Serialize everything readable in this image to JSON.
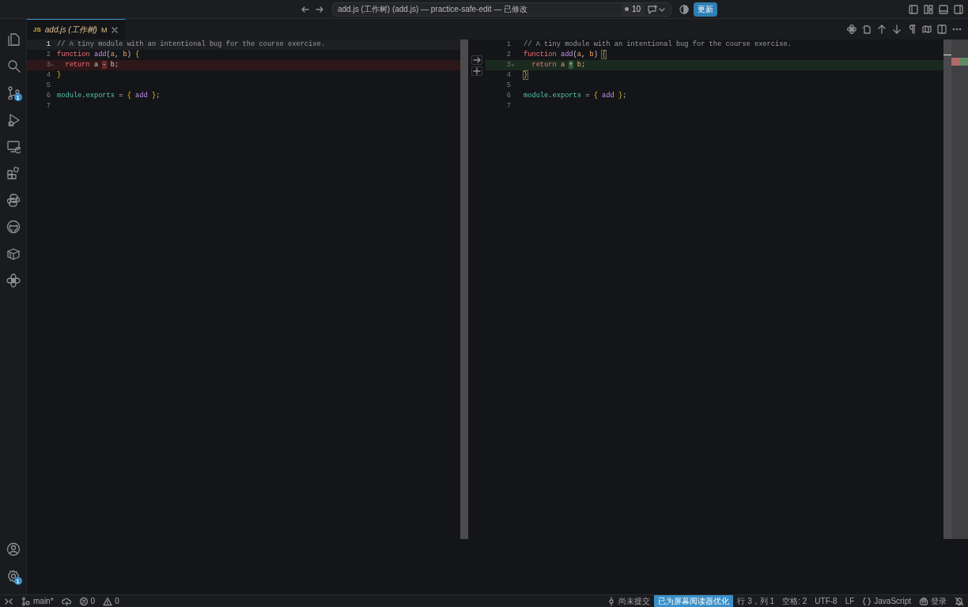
{
  "title_bar": {
    "title": "add.js (工作树) (add.js) — practice-safe-edit — 已修改",
    "changes_count": "10",
    "update_button": "更新"
  },
  "activity_bar": {
    "top": [
      {
        "kind": "files"
      },
      {
        "kind": "search"
      },
      {
        "kind": "source-control",
        "badge": "1"
      },
      {
        "kind": "run-debug"
      },
      {
        "kind": "remote"
      },
      {
        "kind": "extensions"
      },
      {
        "kind": "python"
      },
      {
        "kind": "github"
      },
      {
        "kind": "box"
      },
      {
        "kind": "flower"
      }
    ],
    "bottom": [
      {
        "kind": "account"
      },
      {
        "kind": "settings",
        "badge": "1"
      }
    ]
  },
  "tabs": [
    {
      "file_icon": "JS",
      "label": "add.js (工作树)",
      "status": "M",
      "selected": true
    }
  ],
  "diff": {
    "original": {
      "lines": [
        {
          "number": "1",
          "current": true,
          "kind": "context",
          "tokens": [
            {
              "text": "// A tiny module with an intentional bug for the course exercise.",
              "kind": "comment"
            }
          ]
        },
        {
          "number": "2",
          "current": false,
          "kind": "context",
          "tokens": [
            {
              "text": "function",
              "kind": "keyword"
            },
            {
              "text": " add",
              "kind": "function"
            },
            {
              "text": "(",
              "kind": "plain"
            },
            {
              "text": "a",
              "kind": "param"
            },
            {
              "text": ", ",
              "kind": "plain"
            },
            {
              "text": "b",
              "kind": "param"
            },
            {
              "text": ") ",
              "kind": "plain"
            },
            {
              "text": "{",
              "kind": "bracket"
            }
          ]
        },
        {
          "number": "3",
          "marker": "−",
          "current": false,
          "kind": "removed",
          "tokens": [
            {
              "text": "  return",
              "kind": "keyword"
            },
            {
              "text": " a ",
              "kind": "plain"
            },
            {
              "text": "-",
              "kind": "removed-char"
            },
            {
              "text": " b;",
              "kind": "plain"
            }
          ]
        },
        {
          "number": "4",
          "current": false,
          "kind": "context",
          "tokens": [
            {
              "text": "}",
              "kind": "bracket"
            }
          ]
        },
        {
          "number": "5",
          "current": false,
          "kind": "context"
        },
        {
          "number": "6",
          "current": false,
          "kind": "context",
          "tokens": [
            {
              "text": "module",
              "kind": "property"
            },
            {
              "text": ".",
              "kind": "plain"
            },
            {
              "text": "exports",
              "kind": "property"
            },
            {
              "text": " = ",
              "kind": "plain"
            },
            {
              "text": "{",
              "kind": "bracket"
            },
            {
              "text": " add",
              "kind": "function"
            },
            {
              "text": " }",
              "kind": "bracket"
            },
            {
              "text": ";",
              "kind": "plain"
            }
          ]
        },
        {
          "number": "7",
          "current": false,
          "kind": "context"
        }
      ]
    },
    "modified": {
      "lines": [
        {
          "number": "1",
          "current": false,
          "kind": "context",
          "tokens": [
            {
              "text": "// A tiny module with an intentional bug for the course exercise.",
              "kind": "comment"
            }
          ]
        },
        {
          "number": "2",
          "current": false,
          "kind": "context",
          "tokens": [
            {
              "text": "function",
              "kind": "keyword"
            },
            {
              "text": " add",
              "kind": "function"
            },
            {
              "text": "(",
              "kind": "plain"
            },
            {
              "text": "a",
              "kind": "param"
            },
            {
              "text": ", ",
              "kind": "plain"
            },
            {
              "text": "b",
              "kind": "param"
            },
            {
              "text": ") ",
              "kind": "plain"
            },
            {
              "text": "{",
              "kind": "bracket-match"
            }
          ]
        },
        {
          "number": "3",
          "marker": "+",
          "current": false,
          "kind": "added",
          "tokens": [
            {
              "text": "  return",
              "kind": "keyword"
            },
            {
              "text": " a ",
              "kind": "param"
            },
            {
              "text": "+",
              "kind": "added-char"
            },
            {
              "text": " b",
              "kind": "param"
            },
            {
              "text": ";",
              "kind": "plain"
            }
          ]
        },
        {
          "number": "4",
          "current": false,
          "kind": "context",
          "tokens": [
            {
              "text": "}",
              "kind": "bracket-match"
            }
          ]
        },
        {
          "number": "5",
          "current": false,
          "kind": "context"
        },
        {
          "number": "6",
          "current": false,
          "kind": "context",
          "tokens": [
            {
              "text": "module",
              "kind": "property"
            },
            {
              "text": ".",
              "kind": "plain"
            },
            {
              "text": "exports",
              "kind": "property"
            },
            {
              "text": " = ",
              "kind": "plain"
            },
            {
              "text": "{",
              "kind": "bracket"
            },
            {
              "text": " add",
              "kind": "function"
            },
            {
              "text": " }",
              "kind": "bracket"
            },
            {
              "text": ";",
              "kind": "plain"
            }
          ]
        },
        {
          "number": "7",
          "current": false,
          "kind": "context"
        }
      ]
    }
  },
  "status_bar": {
    "left": [
      {
        "kind": "remote"
      },
      {
        "kind": "branch",
        "text": "main*"
      },
      {
        "kind": "publish"
      },
      {
        "kind": "errors",
        "text": "0"
      },
      {
        "kind": "warnings",
        "text": "0"
      }
    ],
    "right": [
      {
        "kind": "commit",
        "text": "尚未提交"
      },
      {
        "kind": "screen-reader",
        "text": "已为屏幕阅读器优化"
      },
      {
        "kind": "plain",
        "text": "行 3，列 1"
      },
      {
        "kind": "plain",
        "text": "空格: 2"
      },
      {
        "kind": "plain",
        "text": "UTF-8"
      },
      {
        "kind": "plain",
        "text": "LF"
      },
      {
        "kind": "language",
        "text": "JavaScript"
      },
      {
        "kind": "copilot",
        "text": "登录"
      },
      {
        "kind": "bell"
      }
    ]
  }
}
